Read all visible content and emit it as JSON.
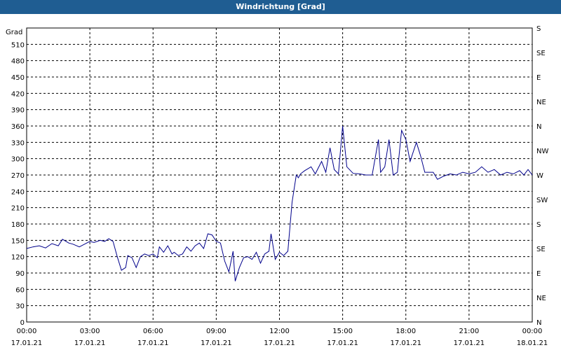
{
  "window": {
    "title": "Windrichtung [Grad]"
  },
  "chart_data": {
    "type": "line",
    "title": "Windrichtung [Grad]",
    "ylabel": "Grad",
    "xlabel": "",
    "ylim": [
      0,
      540
    ],
    "y_ticks": [
      0,
      30,
      60,
      90,
      120,
      150,
      180,
      210,
      240,
      270,
      300,
      330,
      360,
      390,
      420,
      450,
      480,
      510
    ],
    "y_right_ticks": [
      {
        "value": 0,
        "label": "N"
      },
      {
        "value": 45,
        "label": "NE"
      },
      {
        "value": 90,
        "label": "E"
      },
      {
        "value": 135,
        "label": "SE"
      },
      {
        "value": 180,
        "label": "S"
      },
      {
        "value": 225,
        "label": "SW"
      },
      {
        "value": 270,
        "label": "W"
      },
      {
        "value": 315,
        "label": "NW"
      },
      {
        "value": 360,
        "label": "N"
      },
      {
        "value": 405,
        "label": "NE"
      },
      {
        "value": 450,
        "label": "E"
      },
      {
        "value": 495,
        "label": "SE"
      },
      {
        "value": 540,
        "label": "S"
      }
    ],
    "x_range_hours": [
      0,
      24
    ],
    "x_ticks": [
      {
        "hour": 0,
        "time": "00:00",
        "date": "17.01.21"
      },
      {
        "hour": 3,
        "time": "03:00",
        "date": "17.01.21"
      },
      {
        "hour": 6,
        "time": "06:00",
        "date": "17.01.21"
      },
      {
        "hour": 9,
        "time": "09:00",
        "date": "17.01.21"
      },
      {
        "hour": 12,
        "time": "12:00",
        "date": "17.01.21"
      },
      {
        "hour": 15,
        "time": "15:00",
        "date": "17.01.21"
      },
      {
        "hour": 18,
        "time": "18:00",
        "date": "17.01.21"
      },
      {
        "hour": 21,
        "time": "21:00",
        "date": "17.01.21"
      },
      {
        "hour": 24,
        "time": "00:00",
        "date": "18.01.21"
      }
    ],
    "grid": true,
    "line_color": "#00008b",
    "series": [
      {
        "x": [
          0.0,
          0.3,
          0.6,
          0.9,
          1.2,
          1.5,
          1.7,
          2.0,
          2.2,
          2.5,
          2.7,
          3.0,
          3.2,
          3.5,
          3.7,
          3.9,
          4.1,
          4.3,
          4.5,
          4.7,
          4.8,
          5.0,
          5.2,
          5.4,
          5.6,
          5.8,
          6.0,
          6.2,
          6.3,
          6.5,
          6.7,
          6.9,
          7.0,
          7.2,
          7.4,
          7.6,
          7.8,
          8.0,
          8.2,
          8.4,
          8.6,
          8.8,
          9.0,
          9.2,
          9.4,
          9.6,
          9.8,
          9.9,
          10.1,
          10.3,
          10.5,
          10.7,
          10.9,
          11.1,
          11.3,
          11.5,
          11.6,
          11.8,
          12.0,
          12.2,
          12.4,
          12.6,
          12.8,
          12.9,
          13.0,
          13.2,
          13.5,
          13.7,
          14.0,
          14.2,
          14.4,
          14.6,
          14.8,
          15.0,
          15.2,
          15.5,
          15.8,
          16.1,
          16.4,
          16.7,
          16.8,
          17.0,
          17.2,
          17.4,
          17.6,
          17.8,
          18.0,
          18.2,
          18.5,
          18.7,
          18.9,
          19.1,
          19.3,
          19.5,
          19.8,
          20.1,
          20.4,
          20.7,
          21.0,
          21.3,
          21.6,
          21.9,
          22.2,
          22.5,
          22.8,
          23.1,
          23.4,
          23.6,
          23.8,
          24.0
        ],
        "y": [
          135,
          138,
          140,
          136,
          144,
          140,
          152,
          145,
          143,
          138,
          142,
          148,
          146,
          150,
          148,
          153,
          148,
          120,
          95,
          100,
          122,
          118,
          100,
          120,
          125,
          122,
          125,
          118,
          138,
          128,
          140,
          125,
          128,
          122,
          125,
          138,
          130,
          140,
          145,
          135,
          162,
          160,
          148,
          145,
          112,
          92,
          130,
          75,
          100,
          118,
          120,
          115,
          128,
          108,
          125,
          130,
          162,
          115,
          128,
          122,
          130,
          220,
          270,
          265,
          272,
          278,
          285,
          272,
          295,
          275,
          320,
          280,
          272,
          360,
          285,
          273,
          272,
          270,
          270,
          335,
          275,
          285,
          335,
          270,
          275,
          352,
          335,
          295,
          330,
          305,
          275,
          275,
          275,
          262,
          268,
          272,
          270,
          275,
          272,
          275,
          285,
          275,
          280,
          270,
          275,
          272,
          278,
          270,
          280,
          270
        ]
      }
    ]
  }
}
